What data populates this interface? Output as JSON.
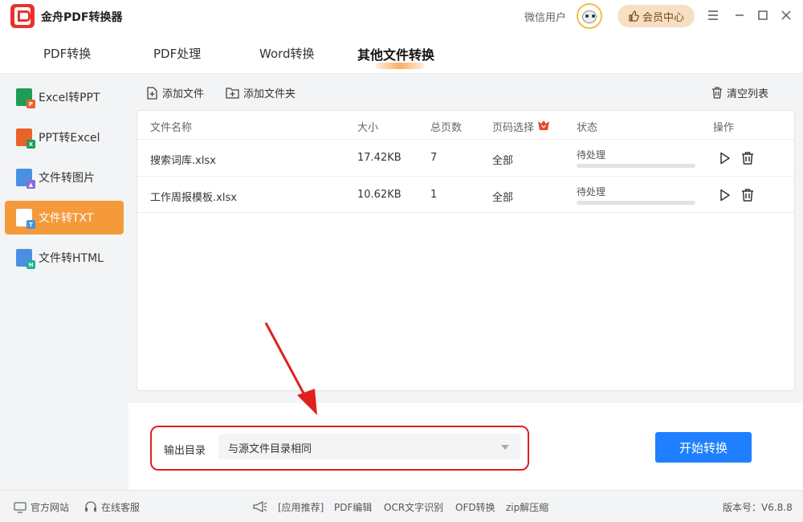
{
  "app": {
    "title": "金舟PDF转换器",
    "user_name": "微信用户",
    "vip_label": "会员中心"
  },
  "tabs": [
    {
      "label": "PDF转换"
    },
    {
      "label": "PDF处理"
    },
    {
      "label": "Word转换"
    },
    {
      "label": "其他文件转换"
    }
  ],
  "sidebar": {
    "items": [
      {
        "label": "Excel转PPT"
      },
      {
        "label": "PPT转Excel"
      },
      {
        "label": "文件转图片"
      },
      {
        "label": "文件转TXT"
      },
      {
        "label": "文件转HTML"
      }
    ]
  },
  "toolbar": {
    "add_file": "添加文件",
    "add_folder": "添加文件夹",
    "clear_list": "清空列表"
  },
  "table": {
    "headers": {
      "name": "文件名称",
      "size": "大小",
      "pages": "总页数",
      "page_select": "页码选择",
      "status": "状态",
      "actions": "操作"
    },
    "rows": [
      {
        "name": "搜索词库.xlsx",
        "size": "17.42KB",
        "pages": "7",
        "page_select": "全部",
        "status": "待处理",
        "progress": 0
      },
      {
        "name": "工作周报模板.xlsx",
        "size": "10.62KB",
        "pages": "1",
        "page_select": "全部",
        "status": "待处理",
        "progress": 0
      }
    ]
  },
  "output": {
    "label": "输出目录",
    "value": "与源文件目录相同"
  },
  "start_button": "开始转换",
  "footer": {
    "website": "官方网站",
    "support": "在线客服",
    "recommend": "[应用推荐]",
    "links": [
      "PDF编辑",
      "OCR文字识别",
      "OFD转换",
      "zip解压缩"
    ],
    "version": "版本号：V6.8.8"
  },
  "colors": {
    "accent": "#1e80ff",
    "active_side": "#f59a3a",
    "highlight": "#e02020"
  }
}
